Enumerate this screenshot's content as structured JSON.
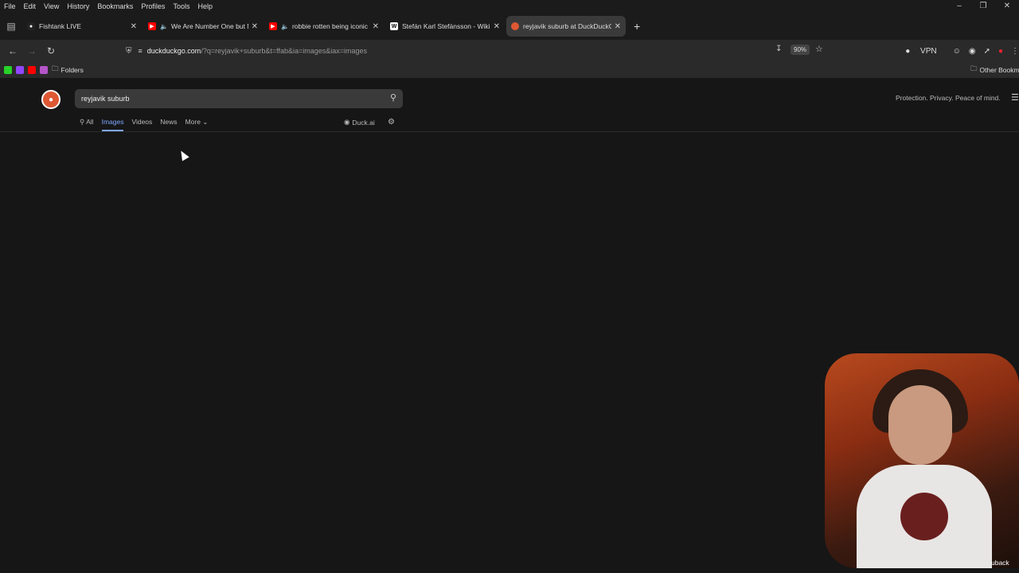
{
  "menubar": {
    "items": [
      "File",
      "Edit",
      "View",
      "History",
      "Bookmarks",
      "Profiles",
      "Tools",
      "Help"
    ]
  },
  "tabs": [
    {
      "label": "Fishtank LIVE",
      "favicon": "fishtank-icon",
      "color": "#222222",
      "muted": false,
      "active": false
    },
    {
      "label": "We Are Number One but N",
      "favicon": "youtube-icon",
      "color": "#ff0000",
      "muted": true,
      "active": false
    },
    {
      "label": "robbie rotten being iconic I",
      "favicon": "youtube-icon",
      "color": "#ff0000",
      "muted": true,
      "active": false
    },
    {
      "label": "Stefán Karl Stefánsson - Wikipe",
      "favicon": "wikipedia-icon",
      "color": "#ffffff",
      "muted": false,
      "active": false
    },
    {
      "label": "reyjavik suburb at DuckDuckGo",
      "favicon": "duckduckgo-icon",
      "color": "#de5833",
      "muted": false,
      "active": true
    }
  ],
  "address": {
    "host": "duckduckgo.com",
    "path": "/?q=reyjavik+suburb&t=ffab&ia=images&iax=images",
    "zoom": "90%"
  },
  "toolbar": {
    "vpn": "VPN"
  },
  "bookmarks": {
    "folders": "Folders",
    "other": "Other Bookmarks"
  },
  "search": {
    "query": "reyjavik suburb"
  },
  "tagline": "Protection. Privacy. Peace of mind.",
  "nav": {
    "all": "All",
    "images": "Images",
    "videos": "Videos",
    "news": "News",
    "more": "More",
    "duck_ai": "Duck.ai"
  },
  "overlay": {
    "feedback": "uback"
  }
}
